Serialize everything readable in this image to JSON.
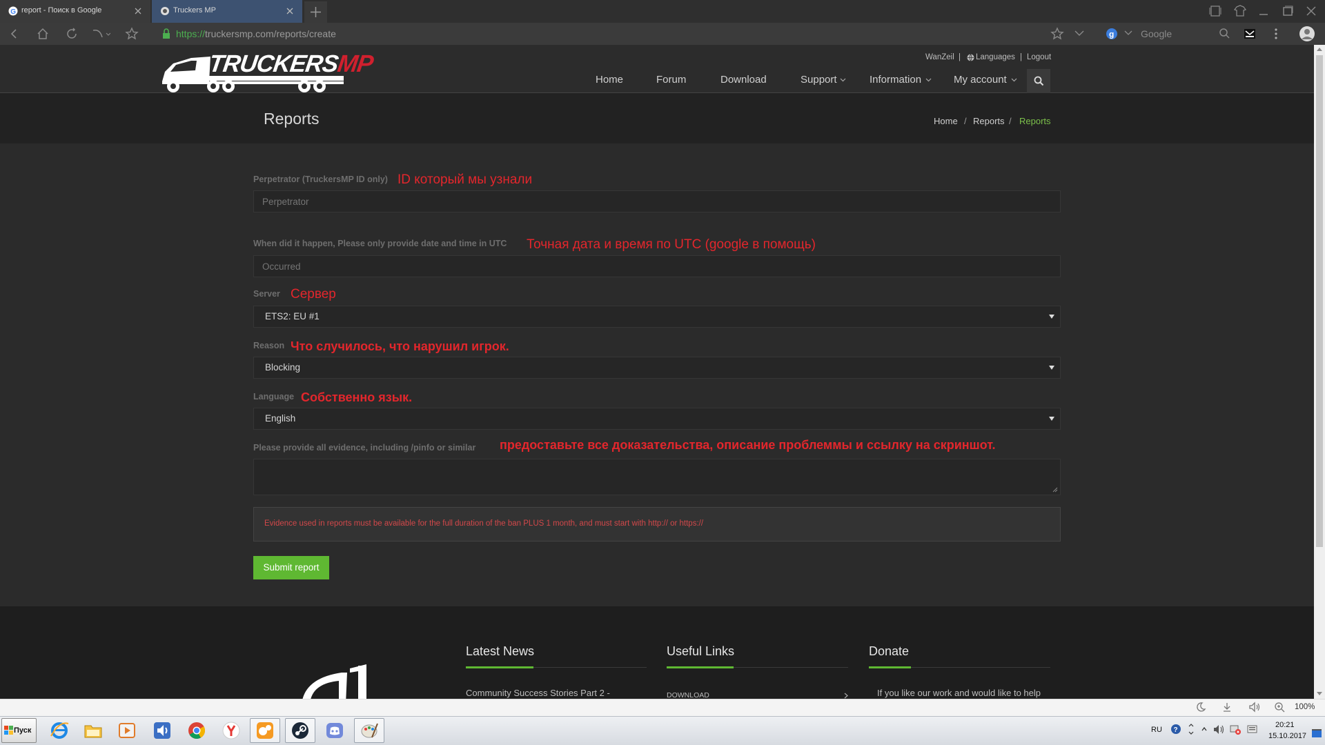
{
  "browser": {
    "tabs": [
      {
        "title": "report - Поиск в Google"
      },
      {
        "title": "Truckers MP"
      }
    ],
    "url": {
      "scheme": "https://",
      "rest": "truckersmp.com/reports/create"
    },
    "search_engine": "Google",
    "zoom": "100%"
  },
  "site": {
    "logo": {
      "text1": "TRUCKERS",
      "text2": "MP"
    },
    "user_links": {
      "user": "WanZeil",
      "sep": "|",
      "languages": "Languages",
      "logout": "Logout"
    },
    "nav": [
      "Home",
      "Forum",
      "Download",
      "Support",
      "Information",
      "My account"
    ],
    "page_title": "Reports",
    "breadcrumb": {
      "items": [
        "Home",
        "Reports",
        "Reports"
      ],
      "sep": "/"
    }
  },
  "form": {
    "perpetrator": {
      "label": "Perpetrator (TruckersMP ID only)",
      "placeholder": "Perpetrator",
      "note": "ID который мы узнали"
    },
    "occurred": {
      "label": "When did it happen, Please only provide date and time in UTC",
      "placeholder": "Occurred",
      "note": "Точная дата и время по UTC (google в помощь)"
    },
    "server": {
      "label": "Server",
      "value": "ETS2: EU #1",
      "note": "Сервер"
    },
    "reason": {
      "label": "Reason",
      "value": "Blocking",
      "note": "Что случилось, что нарушил игрок."
    },
    "language": {
      "label": "Language",
      "value": "English",
      "note": "Собственно язык."
    },
    "evidence": {
      "label": "Please provide all evidence, including /pinfo or similar",
      "value": "",
      "note": "предоставьте все доказательства, описание проблеммы и ссылку на скриншот."
    },
    "notice": "Evidence used in reports must be available for the full duration of the ban PLUS 1 month, and must start with http:// or https://",
    "submit": "Submit report"
  },
  "footer": {
    "news": {
      "heading": "Latest News",
      "item": "Community Success Stories Part 2 -"
    },
    "links": {
      "heading": "Useful Links",
      "item": "DOWNLOAD"
    },
    "donate": {
      "heading": "Donate",
      "text": "If you like our work and would like to help"
    }
  },
  "taskbar": {
    "start": "Пуск",
    "lang": "RU",
    "time": "20:21",
    "date": "15.10.2017"
  },
  "colors": {
    "accent_green": "#5fb832",
    "annotation_red": "#e3262c",
    "logo_red": "#d0202e",
    "breadcrumb_active": "#7cc04b"
  }
}
